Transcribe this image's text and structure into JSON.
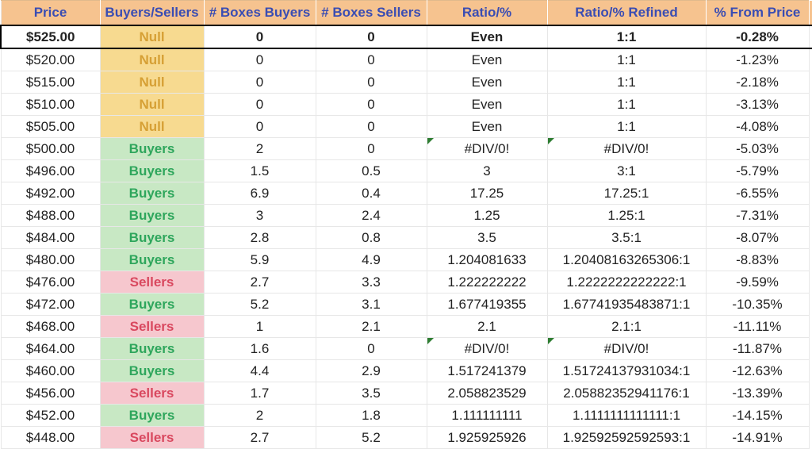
{
  "headers": {
    "price": "Price",
    "bs": "Buyers/Sellers",
    "boxes_buyers": "# Boxes Buyers",
    "boxes_sellers": "# Boxes Sellers",
    "ratio": "Ratio/%",
    "ratio_refined": "Ratio/% Refined",
    "from_price": "% From Price"
  },
  "rows": [
    {
      "price": "$525.00",
      "bs": "Null",
      "bs_class": "null",
      "bb": "0",
      "bsell": "0",
      "ratio": "Even",
      "rr": "1:1",
      "fp": "-0.28%",
      "hl": true
    },
    {
      "price": "$520.00",
      "bs": "Null",
      "bs_class": "null",
      "bb": "0",
      "bsell": "0",
      "ratio": "Even",
      "rr": "1:1",
      "fp": "-1.23%"
    },
    {
      "price": "$515.00",
      "bs": "Null",
      "bs_class": "null",
      "bb": "0",
      "bsell": "0",
      "ratio": "Even",
      "rr": "1:1",
      "fp": "-2.18%"
    },
    {
      "price": "$510.00",
      "bs": "Null",
      "bs_class": "null",
      "bb": "0",
      "bsell": "0",
      "ratio": "Even",
      "rr": "1:1",
      "fp": "-3.13%"
    },
    {
      "price": "$505.00",
      "bs": "Null",
      "bs_class": "null",
      "bb": "0",
      "bsell": "0",
      "ratio": "Even",
      "rr": "1:1",
      "fp": "-4.08%"
    },
    {
      "price": "$500.00",
      "bs": "Buyers",
      "bs_class": "buyers",
      "bb": "2",
      "bsell": "0",
      "ratio": "#DIV/0!",
      "rr": "#DIV/0!",
      "fp": "-5.03%",
      "mark": [
        "ratio",
        "rr"
      ]
    },
    {
      "price": "$496.00",
      "bs": "Buyers",
      "bs_class": "buyers",
      "bb": "1.5",
      "bsell": "0.5",
      "ratio": "3",
      "rr": "3:1",
      "fp": "-5.79%"
    },
    {
      "price": "$492.00",
      "bs": "Buyers",
      "bs_class": "buyers",
      "bb": "6.9",
      "bsell": "0.4",
      "ratio": "17.25",
      "rr": "17.25:1",
      "fp": "-6.55%"
    },
    {
      "price": "$488.00",
      "bs": "Buyers",
      "bs_class": "buyers",
      "bb": "3",
      "bsell": "2.4",
      "ratio": "1.25",
      "rr": "1.25:1",
      "fp": "-7.31%"
    },
    {
      "price": "$484.00",
      "bs": "Buyers",
      "bs_class": "buyers",
      "bb": "2.8",
      "bsell": "0.8",
      "ratio": "3.5",
      "rr": "3.5:1",
      "fp": "-8.07%"
    },
    {
      "price": "$480.00",
      "bs": "Buyers",
      "bs_class": "buyers",
      "bb": "5.9",
      "bsell": "4.9",
      "ratio": "1.204081633",
      "rr": "1.20408163265306:1",
      "fp": "-8.83%"
    },
    {
      "price": "$476.00",
      "bs": "Sellers",
      "bs_class": "sellers",
      "bb": "2.7",
      "bsell": "3.3",
      "ratio": "1.222222222",
      "rr": "1.2222222222222:1",
      "fp": "-9.59%"
    },
    {
      "price": "$472.00",
      "bs": "Buyers",
      "bs_class": "buyers",
      "bb": "5.2",
      "bsell": "3.1",
      "ratio": "1.677419355",
      "rr": "1.67741935483871:1",
      "fp": "-10.35%"
    },
    {
      "price": "$468.00",
      "bs": "Sellers",
      "bs_class": "sellers",
      "bb": "1",
      "bsell": "2.1",
      "ratio": "2.1",
      "rr": "2.1:1",
      "fp": "-11.11%"
    },
    {
      "price": "$464.00",
      "bs": "Buyers",
      "bs_class": "buyers",
      "bb": "1.6",
      "bsell": "0",
      "ratio": "#DIV/0!",
      "rr": "#DIV/0!",
      "fp": "-11.87%",
      "mark": [
        "ratio",
        "rr"
      ]
    },
    {
      "price": "$460.00",
      "bs": "Buyers",
      "bs_class": "buyers",
      "bb": "4.4",
      "bsell": "2.9",
      "ratio": "1.517241379",
      "rr": "1.51724137931034:1",
      "fp": "-12.63%"
    },
    {
      "price": "$456.00",
      "bs": "Sellers",
      "bs_class": "sellers",
      "bb": "1.7",
      "bsell": "3.5",
      "ratio": "2.058823529",
      "rr": "2.05882352941176:1",
      "fp": "-13.39%"
    },
    {
      "price": "$452.00",
      "bs": "Buyers",
      "bs_class": "buyers",
      "bb": "2",
      "bsell": "1.8",
      "ratio": "1.111111111",
      "rr": "1.1111111111111:1",
      "fp": "-14.15%"
    },
    {
      "price": "$448.00",
      "bs": "Sellers",
      "bs_class": "sellers",
      "bb": "2.7",
      "bsell": "5.2",
      "ratio": "1.925925926",
      "rr": "1.92592592592593:1",
      "fp": "-14.91%"
    }
  ]
}
